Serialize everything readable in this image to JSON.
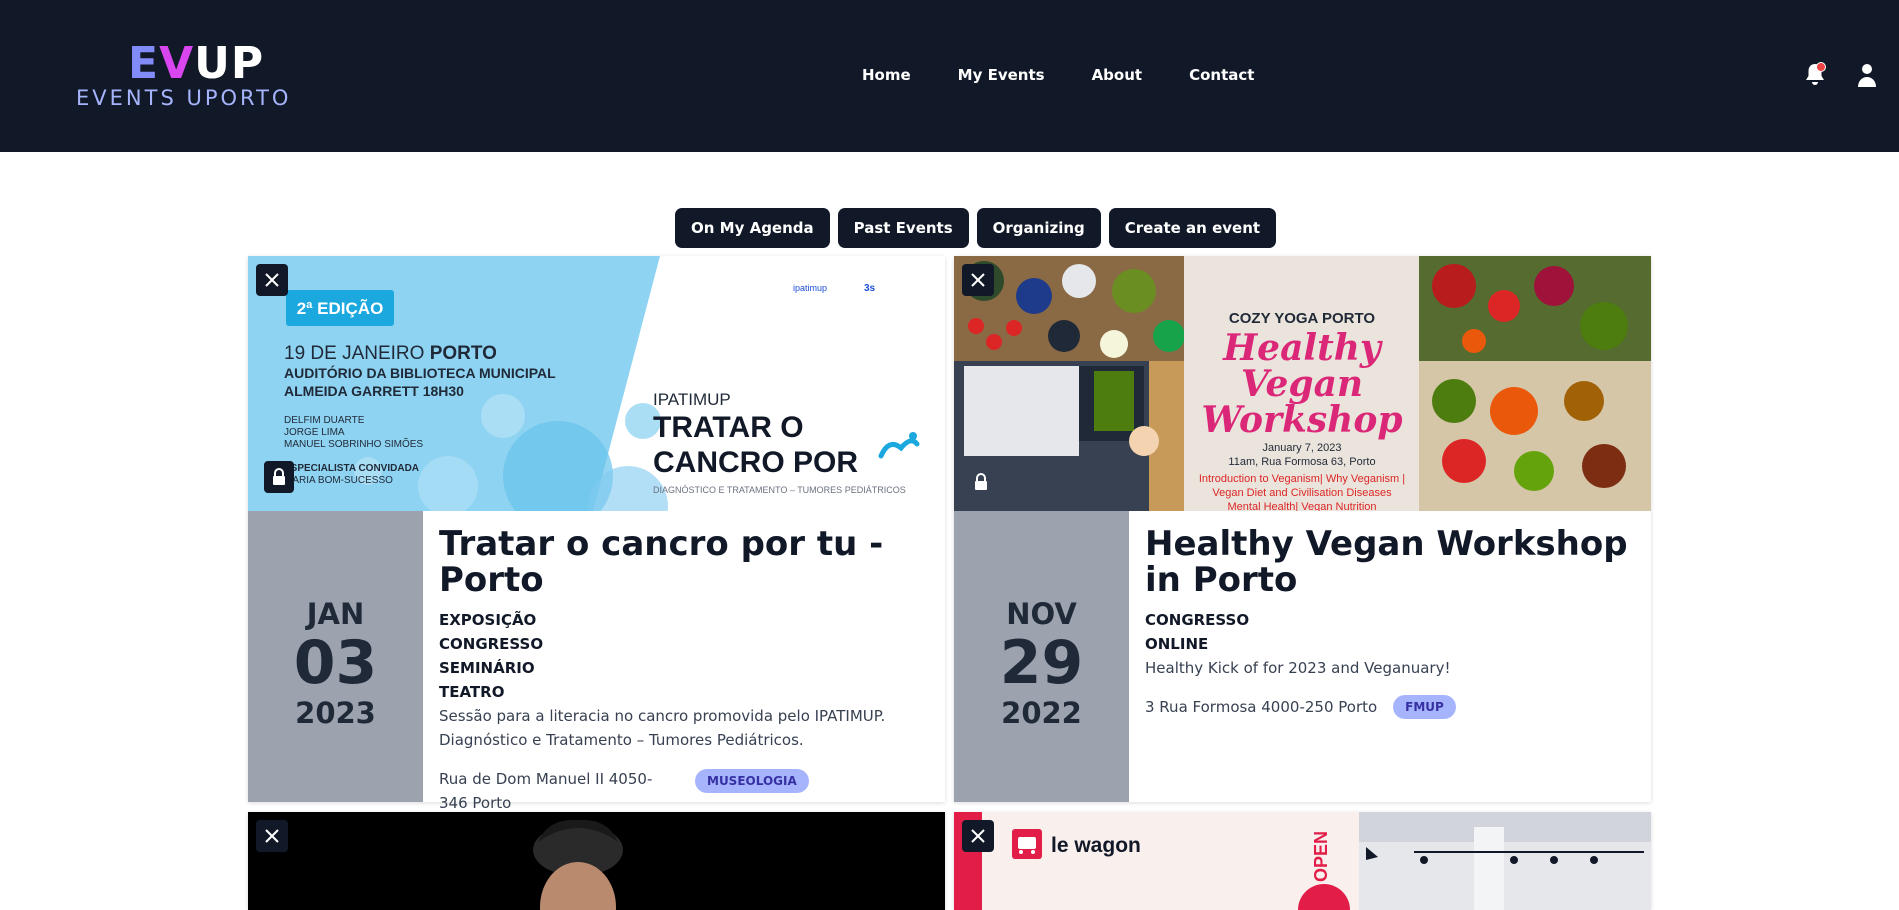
{
  "brand": {
    "logo_main": "EVUP",
    "logo_e": "E",
    "logo_v": "V",
    "logo_rest": "UP",
    "logo_sub": "EVENTS UPORTO"
  },
  "nav": {
    "links": [
      "Home",
      "My Events",
      "About",
      "Contact"
    ]
  },
  "tabs": [
    "On My Agenda",
    "Past Events",
    "Organizing",
    "Create an event"
  ],
  "events": [
    {
      "title": "Tratar o cancro por tu - Porto",
      "month": "JAN",
      "day": "03",
      "year": "2023",
      "categories": [
        "EXPOSIÇÃO",
        "CONGRESSO",
        "SEMINÁRIO",
        "TEATRO"
      ],
      "description": "Sessão para a literacia no cancro promovida pelo IPATIMUP. Diagnóstico e Tratamento – Tumores Pediátricos.",
      "location": "Rua de Dom Manuel II 4050-346 Porto",
      "tag": "MUSEOLOGIA",
      "poster": {
        "edition": "2ª EDIÇÃO",
        "date_line": "19 DE JANEIRO",
        "city": "PORTO",
        "venue_1": "AUDITÓRIO DA BIBLIOTECA MUNICIPAL",
        "venue_2": "ALMEIDA GARRETT 18H30",
        "speakers": [
          "DELFIM DUARTE",
          "JORGE LIMA",
          "MANUEL SOBRINHO SIMÕES"
        ],
        "guest_label": "ESPECIALISTA CONVIDADA",
        "guest_name": "MARIA BOM-SUCESSO",
        "org": "IPATIMUP",
        "headline_1": "TRATAR O",
        "headline_2": "CANCRO POR",
        "subtitle": "DIAGNÓSTICO E TRATAMENTO – TUMORES PEDIÁTRICOS"
      }
    },
    {
      "title": "Healthy Vegan Workshop in Porto",
      "month": "NOV",
      "day": "29",
      "year": "2022",
      "categories": [
        "CONGRESSO",
        "ONLINE"
      ],
      "description": "Healthy Kick of for 2023 and Veganuary!",
      "location": "3 Rua Formosa 4000-250 Porto",
      "tag": "FMUP",
      "poster": {
        "org": "COZY YOGA PORTO",
        "script_1": "Healthy",
        "script_2": "Vegan",
        "script_3": "Workshop",
        "date": "January 7, 2023",
        "place": "11am, Rua Formosa 63, Porto",
        "topics_1": "Introduction to Veganism| Why Veganism |",
        "topics_2": "Vegan Diet and Civilisation Diseases",
        "topics_3": "Mental Health| Vegan Nutrition"
      }
    },
    {
      "poster": {}
    },
    {
      "poster": {
        "brand": "le wagon",
        "open": "OPEN"
      }
    }
  ],
  "colors": {
    "navbar": "#111827",
    "accent": "#a5b4fc",
    "date_box": "#9ca3af"
  }
}
